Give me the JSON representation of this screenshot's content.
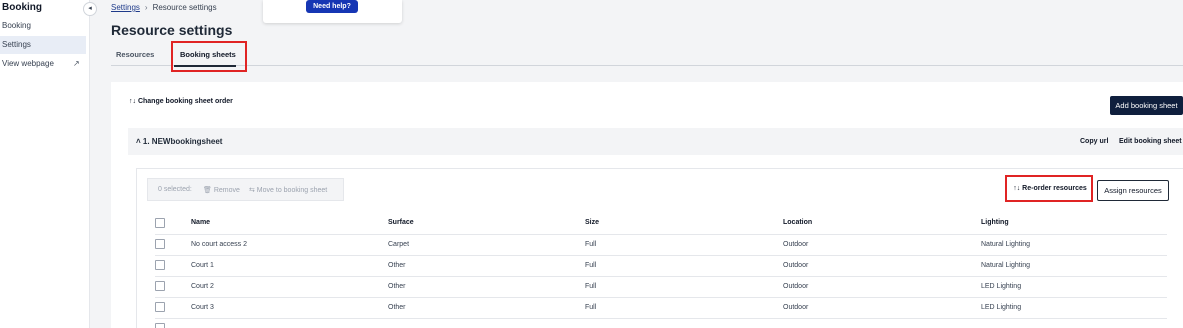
{
  "sidebar": {
    "title": "Booking",
    "items": [
      {
        "label": "Booking"
      },
      {
        "label": "Settings"
      },
      {
        "label": "View webpage"
      }
    ],
    "collapse_icon": "◂",
    "external_icon": "↗"
  },
  "breadcrumb": {
    "parent": "Settings",
    "separator": "›",
    "current": "Resource settings"
  },
  "help": {
    "label": "Need help?"
  },
  "page_title": "Resource settings",
  "tabs": [
    {
      "label": "Resources"
    },
    {
      "label": "Booking sheets"
    }
  ],
  "toolbar": {
    "change_order_label": "↑↓ Change booking sheet order",
    "add_sheet_label": "Add booking sheet"
  },
  "sheet": {
    "name": "˄ 1. NEWbookingsheet",
    "copy_url_label": "Copy url",
    "edit_label": "Edit booking sheet"
  },
  "bulk": {
    "selected": "0 selected:",
    "remove": "🗑 Remove",
    "move": "⇆ Move to booking sheet"
  },
  "actions": {
    "reorder_label": "↑↓ Re-order resources",
    "assign_label": "Assign resources"
  },
  "table": {
    "columns": [
      "Name",
      "Surface",
      "Size",
      "Location",
      "Lighting"
    ],
    "rows": [
      [
        "No court access 2",
        "Carpet",
        "Full",
        "Outdoor",
        "Natural Lighting"
      ],
      [
        "Court 1",
        "Other",
        "Full",
        "Outdoor",
        "Natural Lighting"
      ],
      [
        "Court 2",
        "Other",
        "Full",
        "Outdoor",
        "LED Lighting"
      ],
      [
        "Court 3",
        "Other",
        "Full",
        "Outdoor",
        "LED Lighting"
      ]
    ]
  },
  "colors": {
    "accent": "#1636b4",
    "dark_button": "#0f1f3d",
    "highlight": "#e02424"
  }
}
